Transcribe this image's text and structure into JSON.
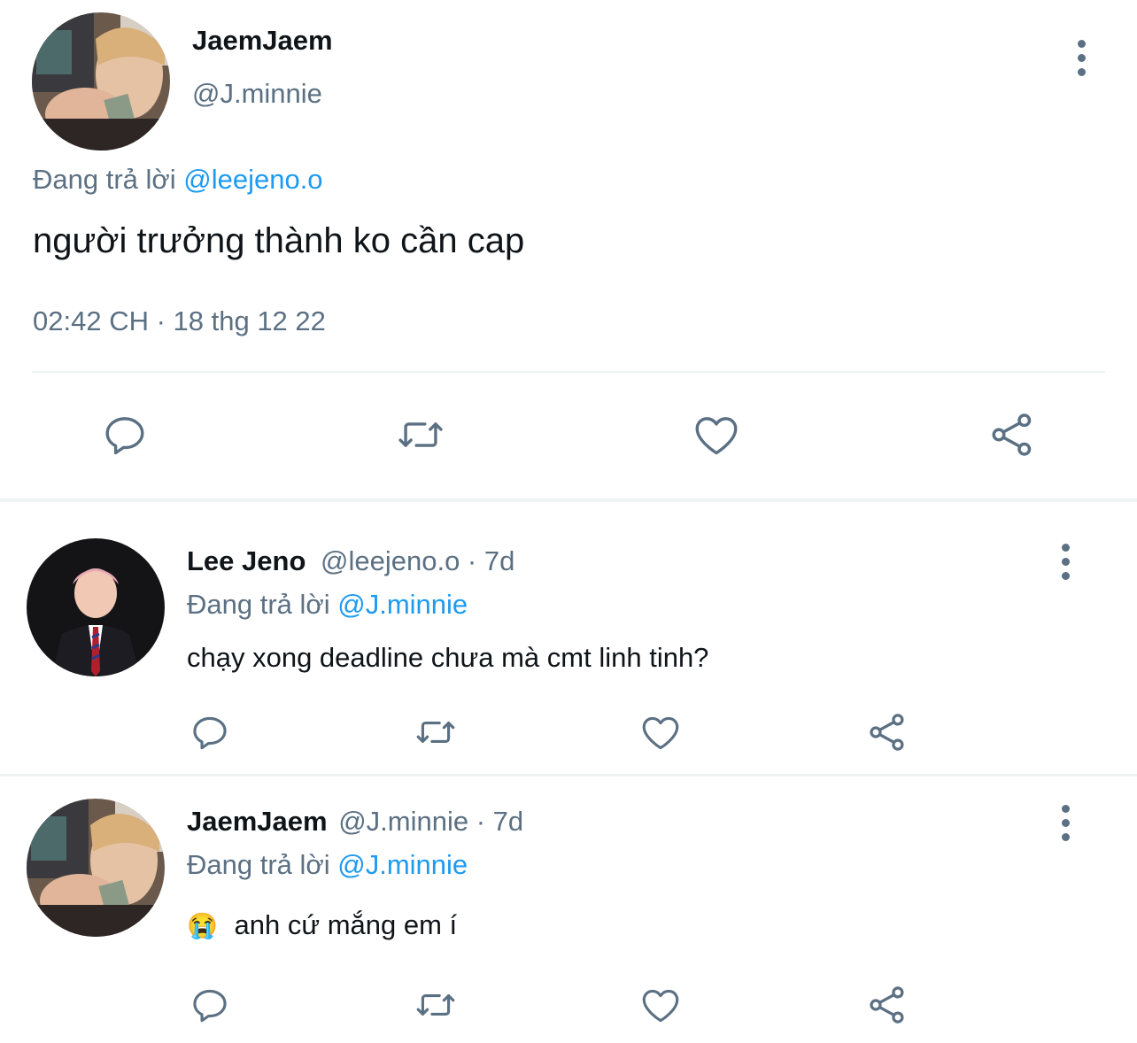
{
  "main_tweet": {
    "display_name": "JaemJaem",
    "handle": "@J.minnie",
    "replying_to_prefix": "Đang trả lời",
    "replying_to_handle": "@leejeno.o",
    "text": "người trưởng thành ko cần cap",
    "timestamp": "02:42 CH · 18 thg 12 22"
  },
  "replies": [
    {
      "display_name": "Lee Jeno",
      "handle_time": "@leejeno.o · 7d",
      "replying_to_prefix": "Đang trả lời",
      "replying_to_handle": "@J.minnie",
      "text": "chạy xong deadline chưa mà cmt linh tinh?"
    },
    {
      "display_name": "JaemJaem",
      "handle_time": "@J.minnie · 7d",
      "replying_to_prefix": "Đang trả lời",
      "replying_to_handle": "@J.minnie",
      "emoji": "😭",
      "text": "anh cứ mắng em í"
    }
  ],
  "icons": [
    "reply-icon",
    "retweet-icon",
    "like-icon",
    "share-icon",
    "more-icon"
  ],
  "colors": {
    "text": "#0f1419",
    "muted": "#5b7083",
    "link": "#1d9bf0",
    "divider": "#eff3f4"
  }
}
